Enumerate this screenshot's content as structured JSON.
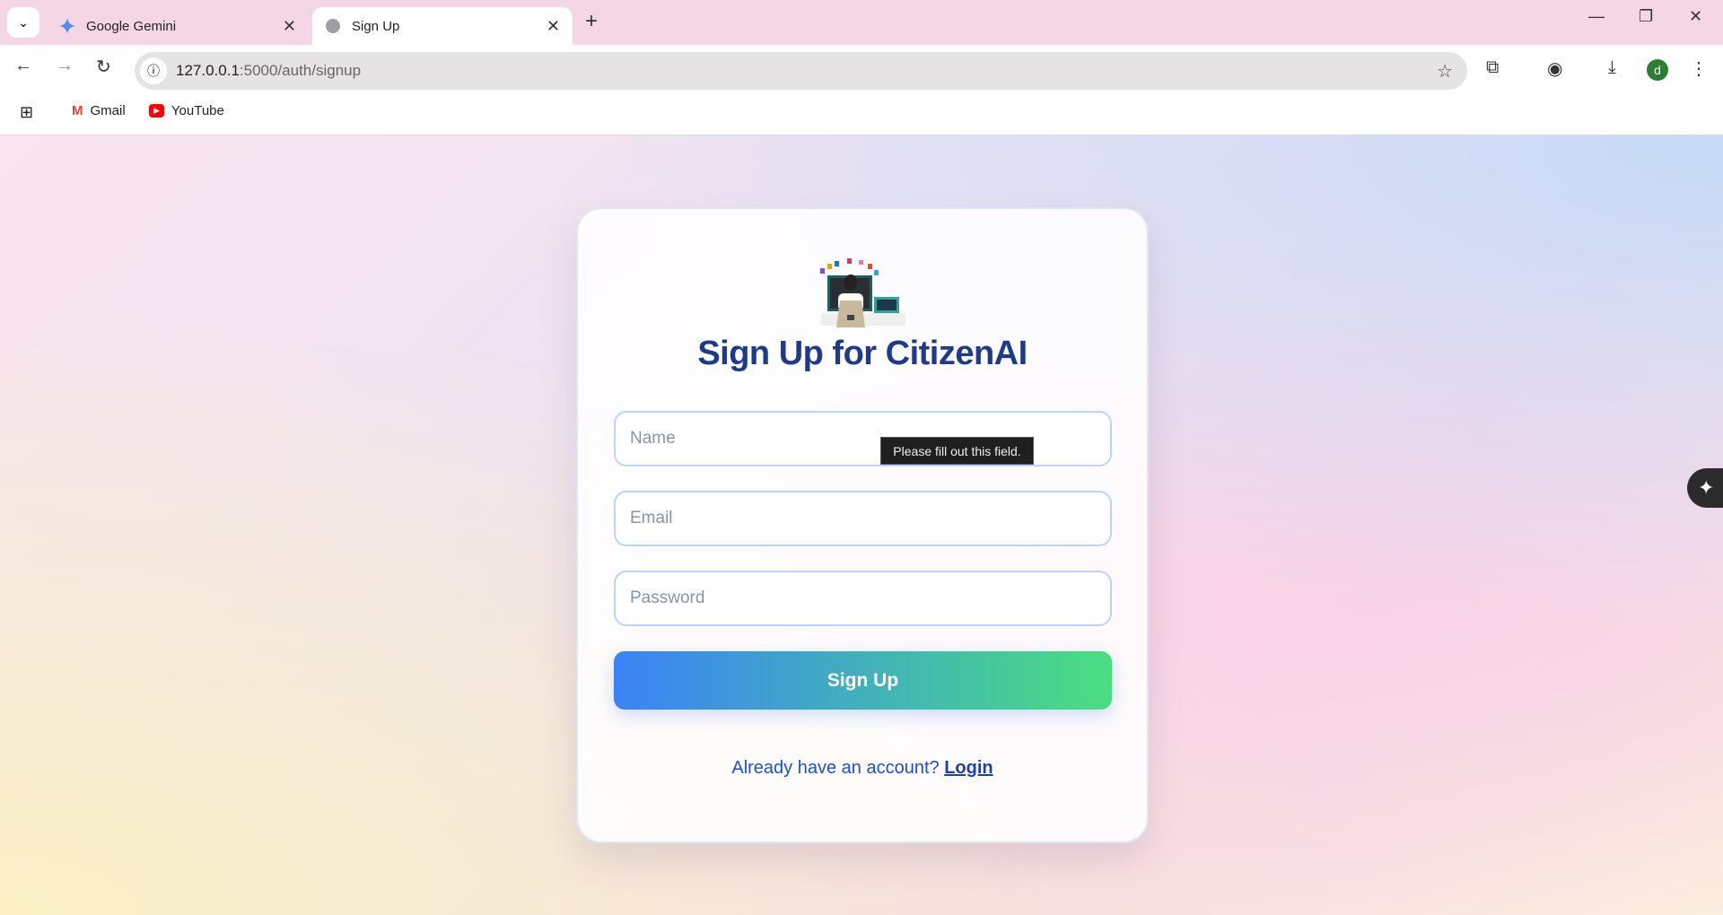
{
  "browser": {
    "tabs": [
      {
        "title": "Google Gemini",
        "icon": "gemini-icon",
        "active": false
      },
      {
        "title": "Sign Up",
        "icon": "globe-icon",
        "active": true
      }
    ],
    "url_host": "127.0.0.1",
    "url_rest": ":5000/auth/signup",
    "bookmarks": [
      {
        "label": "Gmail",
        "icon": "gmail-icon"
      },
      {
        "label": "YouTube",
        "icon": "youtube-icon"
      }
    ],
    "profile_initial": "d"
  },
  "card": {
    "title": "Sign Up for CitizenAI",
    "name_placeholder": "Name",
    "email_placeholder": "Email",
    "password_placeholder": "Password",
    "submit_label": "Sign Up",
    "login_prompt": "Already have an account?",
    "login_link": "Login"
  },
  "tooltip": "Please fill out this field.",
  "colors": {
    "title": "#1e3a8a",
    "button_start": "#3b82f6",
    "button_end": "#4ade80",
    "link": "#1d4ed8"
  }
}
